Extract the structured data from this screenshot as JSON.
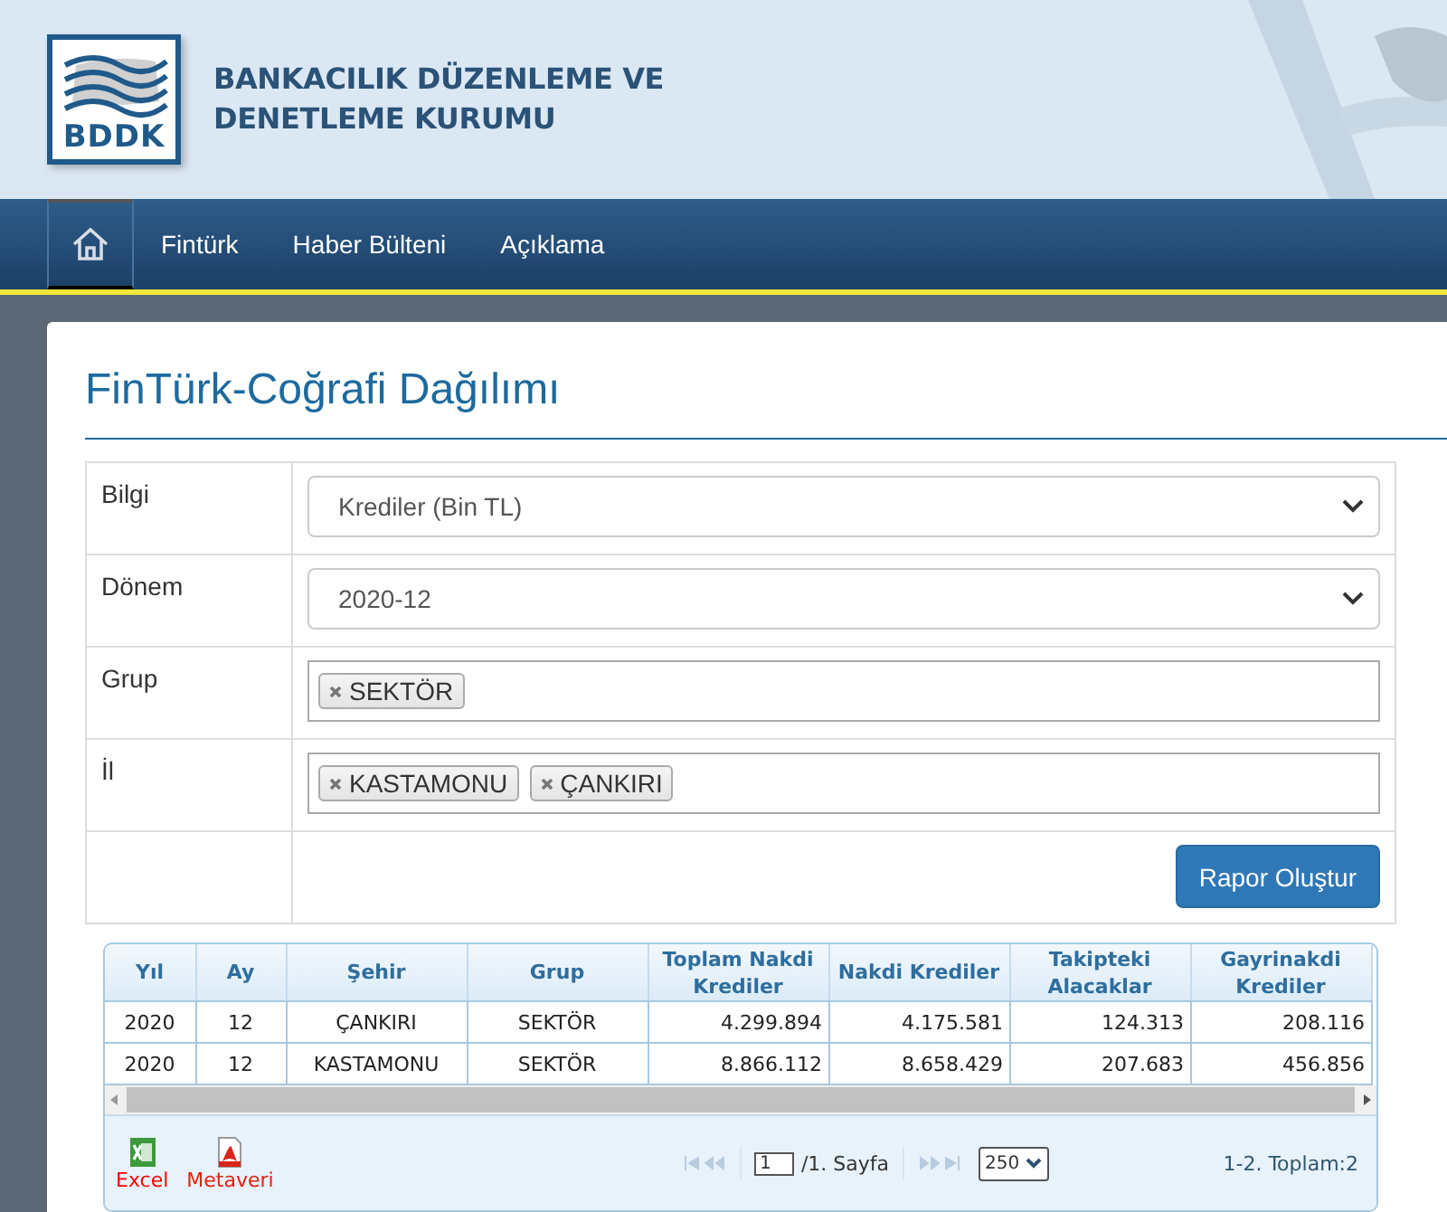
{
  "header": {
    "logo_text": "BDDK",
    "title_lines": [
      "BANKACILIK DÜZENLEME VE",
      "DENETLEME KURUMU"
    ]
  },
  "nav": {
    "items": [
      {
        "kind": "home"
      },
      {
        "kind": "link",
        "label": "Fintürk"
      },
      {
        "kind": "link",
        "label": "Haber Bülteni"
      },
      {
        "kind": "link",
        "label": "Açıklama"
      }
    ]
  },
  "page_title": "FinTürk-Coğrafi Dağılımı",
  "form": [
    {
      "kind": "select",
      "label": "Bilgi",
      "value": "Krediler (Bin TL)"
    },
    {
      "kind": "select",
      "label": "Dönem",
      "value": "2020-12"
    },
    {
      "kind": "tags",
      "label": "Grup",
      "tags": [
        "SEKTÖR"
      ]
    },
    {
      "kind": "tags",
      "label": "İl",
      "tags": [
        "KASTAMONU",
        "ÇANKIRI"
      ]
    },
    {
      "kind": "button",
      "label": "Rapor Oluştur"
    }
  ],
  "grid": {
    "columns": [
      {
        "label": "Yıl",
        "kind": "text"
      },
      {
        "label": "Ay",
        "kind": "text"
      },
      {
        "label": "Şehir",
        "kind": "text"
      },
      {
        "label": "Grup",
        "kind": "text"
      },
      {
        "label": "Toplam Nakdi Krediler",
        "kind": "number"
      },
      {
        "label": "Nakdi Krediler",
        "kind": "number"
      },
      {
        "label": "Takipteki Alacaklar",
        "kind": "number"
      },
      {
        "label": "Gayrinakdi Krediler",
        "kind": "number"
      }
    ],
    "rows": [
      [
        "2020",
        "12",
        "ÇANKIRI",
        "SEKTÖR",
        "4.299.894",
        "4.175.581",
        "124.313",
        "208.116"
      ],
      [
        "2020",
        "12",
        "KASTAMONU",
        "SEKTÖR",
        "8.866.112",
        "8.658.429",
        "207.683",
        "456.856"
      ]
    ],
    "exports": [
      {
        "kind": "excel",
        "label": "Excel"
      },
      {
        "kind": "pdf",
        "label": "Metaveri"
      }
    ],
    "pager": {
      "page": "1",
      "page_label": "/1. Sayfa",
      "page_size": "250",
      "summary": "1-2. Toplam:2"
    }
  }
}
